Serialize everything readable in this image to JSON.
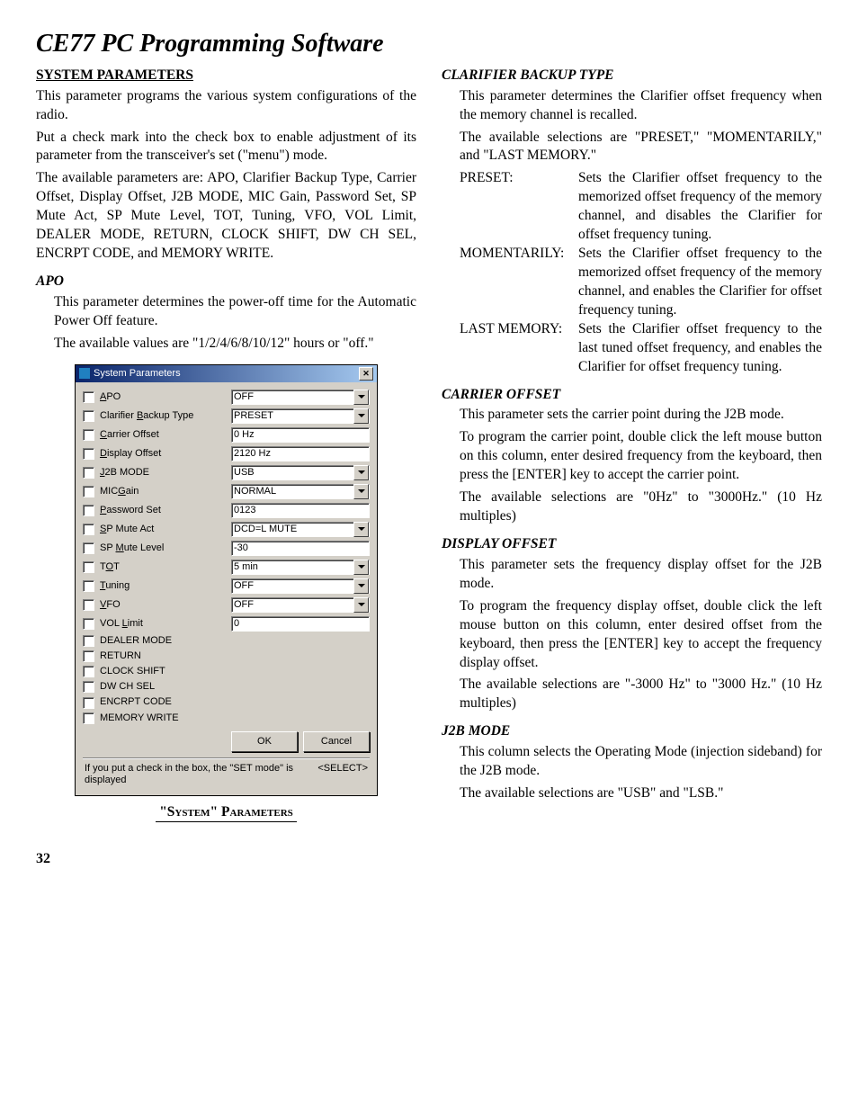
{
  "title": "CE77 PC Programming Software",
  "left": {
    "heading": "SYSTEM PARAMETERS",
    "p1": "This parameter programs the various system configurations of the radio.",
    "p2": "Put a check mark into the check box to enable adjustment of its parameter from the transceiver's set (\"menu\") mode.",
    "p3": "The available parameters are: APO, Clarifier Backup Type, Carrier Offset, Display Offset, J2B MODE, MIC Gain, Password Set, SP Mute Act, SP Mute Level, TOT, Tuning, VFO, VOL Limit, DEALER MODE, RETURN, CLOCK SHIFT, DW CH SEL, ENCRPT CODE, and MEMORY WRITE.",
    "apo_head": "APO",
    "apo_p1": "This parameter determines the power-off time for the Automatic Power Off feature.",
    "apo_p2": "The available values are \"1/2/4/6/8/10/12\" hours or \"off.\"",
    "caption": "\"System\" Parameters"
  },
  "dialog": {
    "title": "System Parameters",
    "rows": [
      {
        "pre": "",
        "ul": "A",
        "post": "PO",
        "value": "OFF",
        "dd": true
      },
      {
        "pre": "Clarifier ",
        "ul": "B",
        "post": "ackup Type",
        "value": "PRESET",
        "dd": true
      },
      {
        "pre": "",
        "ul": "C",
        "post": "arrier Offset",
        "value": "0 Hz",
        "dd": false
      },
      {
        "pre": "",
        "ul": "D",
        "post": "isplay Offset",
        "value": "2120 Hz",
        "dd": false
      },
      {
        "pre": "",
        "ul": "J",
        "post": "2B MODE",
        "value": "USB",
        "dd": true
      },
      {
        "pre": "MIC",
        "ul": "G",
        "post": "ain",
        "value": "NORMAL",
        "dd": true
      },
      {
        "pre": "",
        "ul": "P",
        "post": "assword Set",
        "value": "0123",
        "dd": false
      },
      {
        "pre": "",
        "ul": "S",
        "post": "P Mute Act",
        "value": "DCD=L MUTE",
        "dd": true
      },
      {
        "pre": "SP ",
        "ul": "M",
        "post": "ute Level",
        "value": "-30",
        "dd": false
      },
      {
        "pre": "T",
        "ul": "O",
        "post": "T",
        "value": "5 min",
        "dd": true
      },
      {
        "pre": "",
        "ul": "T",
        "post": "uning",
        "value": "OFF",
        "dd": true
      },
      {
        "pre": "",
        "ul": "V",
        "post": "FO",
        "value": "OFF",
        "dd": true
      },
      {
        "pre": "VOL ",
        "ul": "L",
        "post": "imit",
        "value": "0",
        "dd": false
      },
      {
        "pre": "DEALER MODE",
        "ul": "",
        "post": "",
        "value": null,
        "dd": false
      },
      {
        "pre": "RETURN",
        "ul": "",
        "post": "",
        "value": null,
        "dd": false
      },
      {
        "pre": "CLOCK SHIFT",
        "ul": "",
        "post": "",
        "value": null,
        "dd": false
      },
      {
        "pre": "DW CH SEL",
        "ul": "",
        "post": "",
        "value": null,
        "dd": false
      },
      {
        "pre": "ENCRPT CODE",
        "ul": "",
        "post": "",
        "value": null,
        "dd": false
      },
      {
        "pre": "MEMORY WRITE",
        "ul": "",
        "post": "",
        "value": null,
        "dd": false
      }
    ],
    "ok": "OK",
    "cancel": "Cancel",
    "status_left": "If you put a check in the box, the \"SET mode\" is displayed",
    "status_right": "<SELECT>"
  },
  "right": {
    "cbt_head": "CLARIFIER BACKUP TYPE",
    "cbt_p1": "This parameter determines the Clarifier offset frequency when the memory channel is recalled.",
    "cbt_p2": "The available selections are \"PRESET,\" \"MOMENTARILY,\" and \"LAST MEMORY.\"",
    "defs": [
      {
        "label": "PRESET:",
        "text": "Sets the Clarifier offset frequency to the memorized offset frequency of the memory channel, and disables the Clarifier for offset frequency tuning."
      },
      {
        "label": "MOMENTARILY:",
        "text": "Sets the Clarifier offset frequency to the memorized offset frequency of the memory channel, and enables the Clarifier for offset frequency tuning."
      },
      {
        "label": "LAST MEMORY:",
        "text": "Sets the Clarifier offset frequency to the last tuned offset frequency, and enables the Clarifier for offset frequency tuning."
      }
    ],
    "co_head": "CARRIER OFFSET",
    "co_p1": "This parameter sets the carrier point during the J2B mode.",
    "co_p2": "To program the carrier point, double click the left mouse button on this column, enter desired frequency from the keyboard, then press the [ENTER] key to accept the carrier point.",
    "co_p3": "The available selections are \"0Hz\" to \"3000Hz.\" (10 Hz multiples)",
    "do_head": "DISPLAY OFFSET",
    "do_p1": "This parameter sets the frequency display offset for the J2B mode.",
    "do_p2": "To program the frequency display offset, double click the left mouse button on this column, enter desired offset from the keyboard, then press the [ENTER] key to accept the frequency display offset.",
    "do_p3": "The available selections are \"-3000 Hz\" to \"3000 Hz.\" (10 Hz multiples)",
    "j2b_head": "J2B MODE",
    "j2b_p1": "This column selects the Operating Mode (injection sideband) for the J2B mode.",
    "j2b_p2": "The available selections are \"USB\" and \"LSB.\""
  },
  "page": "32"
}
